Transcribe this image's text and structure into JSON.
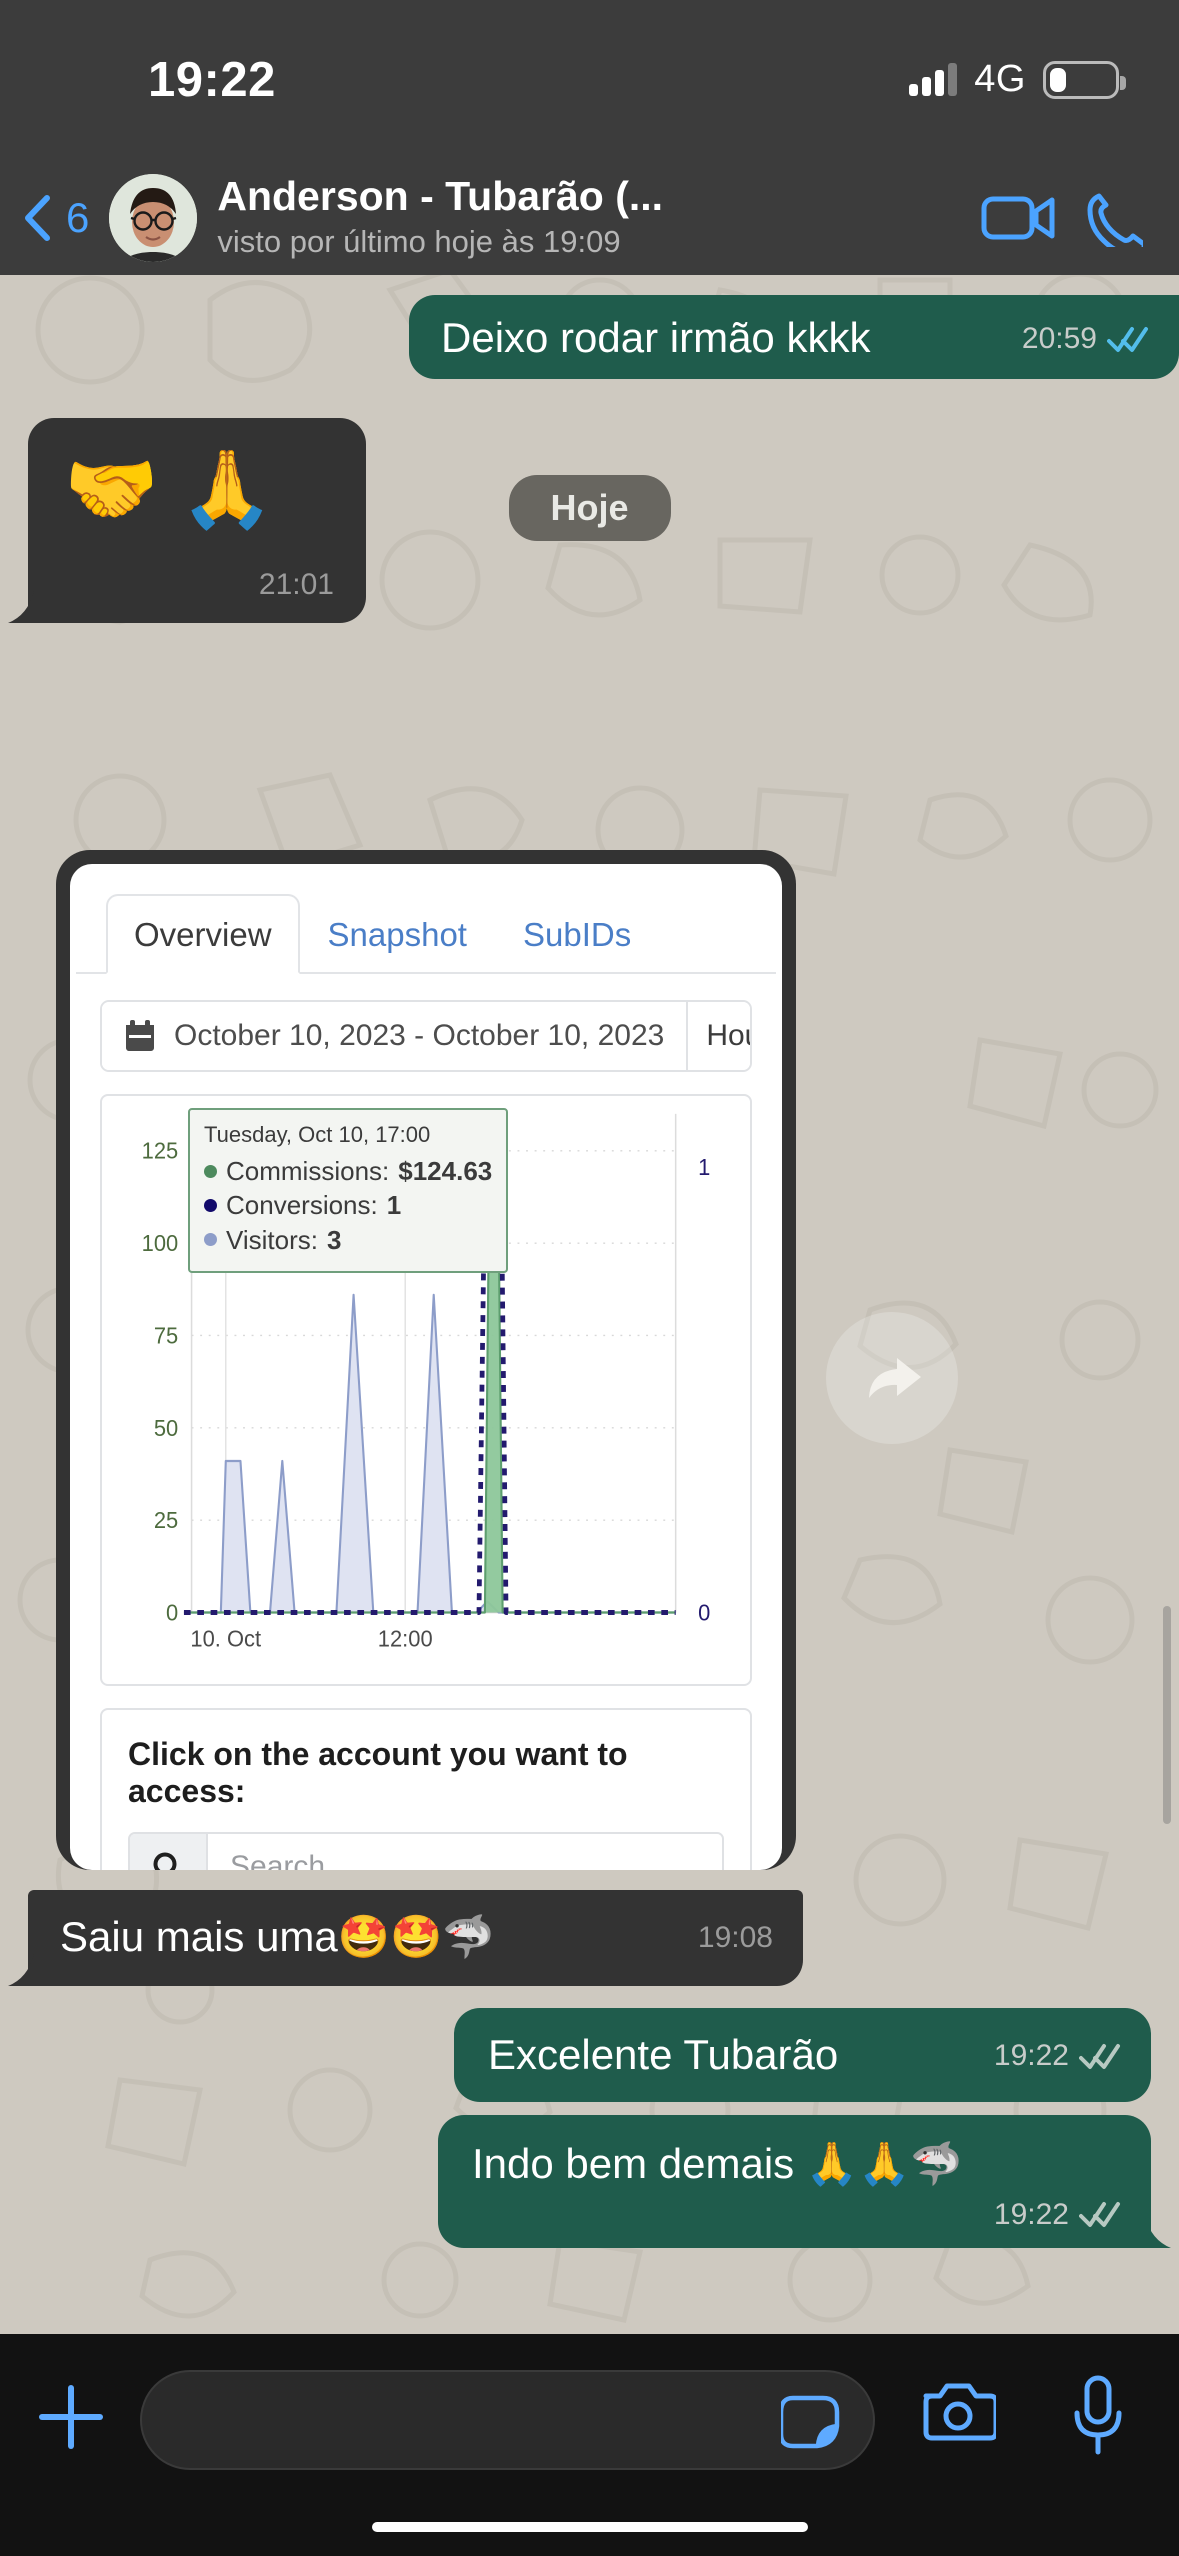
{
  "status_bar": {
    "time": "19:22",
    "network": "4G",
    "signal_bars_filled": 3,
    "signal_bars_total": 4,
    "battery_percent": 26
  },
  "header": {
    "back_icon": "chevron-left-icon",
    "back_count": "6",
    "contact_name": "Anderson - Tubarão (...",
    "contact_status": "visto por último hoje às 19:09",
    "video_icon": "video-camera-icon",
    "call_icon": "phone-icon",
    "accent": "#4ba3ff"
  },
  "date_divider": {
    "label": "Hoje"
  },
  "messages": [
    {
      "direction": "out",
      "text": "Deixo rodar irmão kkkk",
      "time": "20:59",
      "status": "read",
      "status_icon": "double-check-icon"
    },
    {
      "direction": "in",
      "text": "🤝 🙏",
      "emoji_only": true,
      "time": "21:01",
      "status": "none"
    },
    {
      "direction": "in",
      "attachment": "screenshot",
      "text": "Saiu mais uma🤩🤩🦈",
      "time": "19:08",
      "status": "none"
    },
    {
      "direction": "out",
      "text": "Excelente Tubarão",
      "time": "19:22",
      "status": "delivered",
      "status_icon": "double-check-icon"
    },
    {
      "direction": "out",
      "text": "Indo bem demais 🙏🙏🦈",
      "time": "19:22",
      "status": "delivered",
      "status_icon": "double-check-icon"
    }
  ],
  "attachment_card": {
    "tabs": [
      {
        "label": "Overview",
        "active": true
      },
      {
        "label": "Snapshot",
        "active": false
      },
      {
        "label": "SubIDs",
        "active": false
      }
    ],
    "date_range": {
      "calendar_icon": "calendar-icon",
      "value": "October 10, 2023 - October 10, 2023",
      "unit_value": "Hou",
      "unit_icon": "updown-arrows-icon",
      "refresh_icon": "refresh-icon"
    },
    "tooltip": {
      "title": "Tuesday, Oct 10, 17:00",
      "rows": [
        {
          "label": "Commissions:",
          "value": "$124.63",
          "color": "#4d8a5e"
        },
        {
          "label": "Conversions:",
          "value": "1",
          "color": "#120a6b"
        },
        {
          "label": "Visitors:",
          "value": "3",
          "color": "#8d9dc9"
        }
      ]
    },
    "account_section": {
      "title": "Click on the account you want to access:",
      "search_icon": "search-icon",
      "search_value": "",
      "search_placeholder": "Search"
    }
  },
  "chart_data": {
    "type": "area",
    "title": "",
    "xlabel": "",
    "ylabel": "",
    "x_tick_labels": [
      "10. Oct",
      "12:00"
    ],
    "x_tick_positions": [
      0.085,
      0.45
    ],
    "left_axis": {
      "ticks": [
        0,
        25,
        50,
        75,
        100,
        125
      ],
      "ylim": [
        0,
        135
      ],
      "color": "#4d6b3e"
    },
    "right_axis": {
      "ticks": [
        0,
        1
      ],
      "ylim": [
        0,
        1.12
      ],
      "color": "#231a6e"
    },
    "grid": true,
    "legend": "none",
    "series": [
      {
        "name": "Visitors",
        "axis": "left",
        "color": "#8d9dc9",
        "fill": "#dfe3f2",
        "points": [
          [
            0.0,
            0
          ],
          [
            0.075,
            0
          ],
          [
            0.085,
            41
          ],
          [
            0.115,
            41
          ],
          [
            0.135,
            0
          ],
          [
            0.175,
            0
          ],
          [
            0.2,
            41
          ],
          [
            0.225,
            0
          ],
          [
            0.31,
            0
          ],
          [
            0.345,
            86
          ],
          [
            0.385,
            0
          ],
          [
            0.475,
            0
          ],
          [
            0.508,
            86
          ],
          [
            0.545,
            0
          ],
          [
            0.595,
            0
          ],
          [
            0.617,
            3
          ],
          [
            0.64,
            0
          ],
          [
            0.7,
            0
          ],
          [
            1.0,
            0
          ]
        ]
      },
      {
        "name": "Commissions",
        "axis": "left",
        "color": "#5d9e6e",
        "fill": "#8dc79a",
        "points": [
          [
            0.0,
            0
          ],
          [
            0.612,
            0
          ],
          [
            0.622,
            132
          ],
          [
            0.638,
            132
          ],
          [
            0.648,
            0
          ],
          [
            1.0,
            0
          ]
        ]
      },
      {
        "name": "Conversions",
        "axis": "right",
        "color": "#231a6e",
        "style": "dashed",
        "points": [
          [
            0.0,
            0
          ],
          [
            0.6,
            0
          ],
          [
            0.612,
            1
          ],
          [
            0.645,
            1
          ],
          [
            0.655,
            0
          ],
          [
            1.0,
            0
          ]
        ]
      }
    ]
  },
  "input_bar": {
    "plus_icon": "plus-icon",
    "message_value": "",
    "sticker_icon": "sticker-icon",
    "camera_icon": "camera-icon",
    "mic_icon": "microphone-icon",
    "accent": "#5eaaff"
  },
  "overlays": {
    "forward_icon": "forward-arrow-icon"
  }
}
